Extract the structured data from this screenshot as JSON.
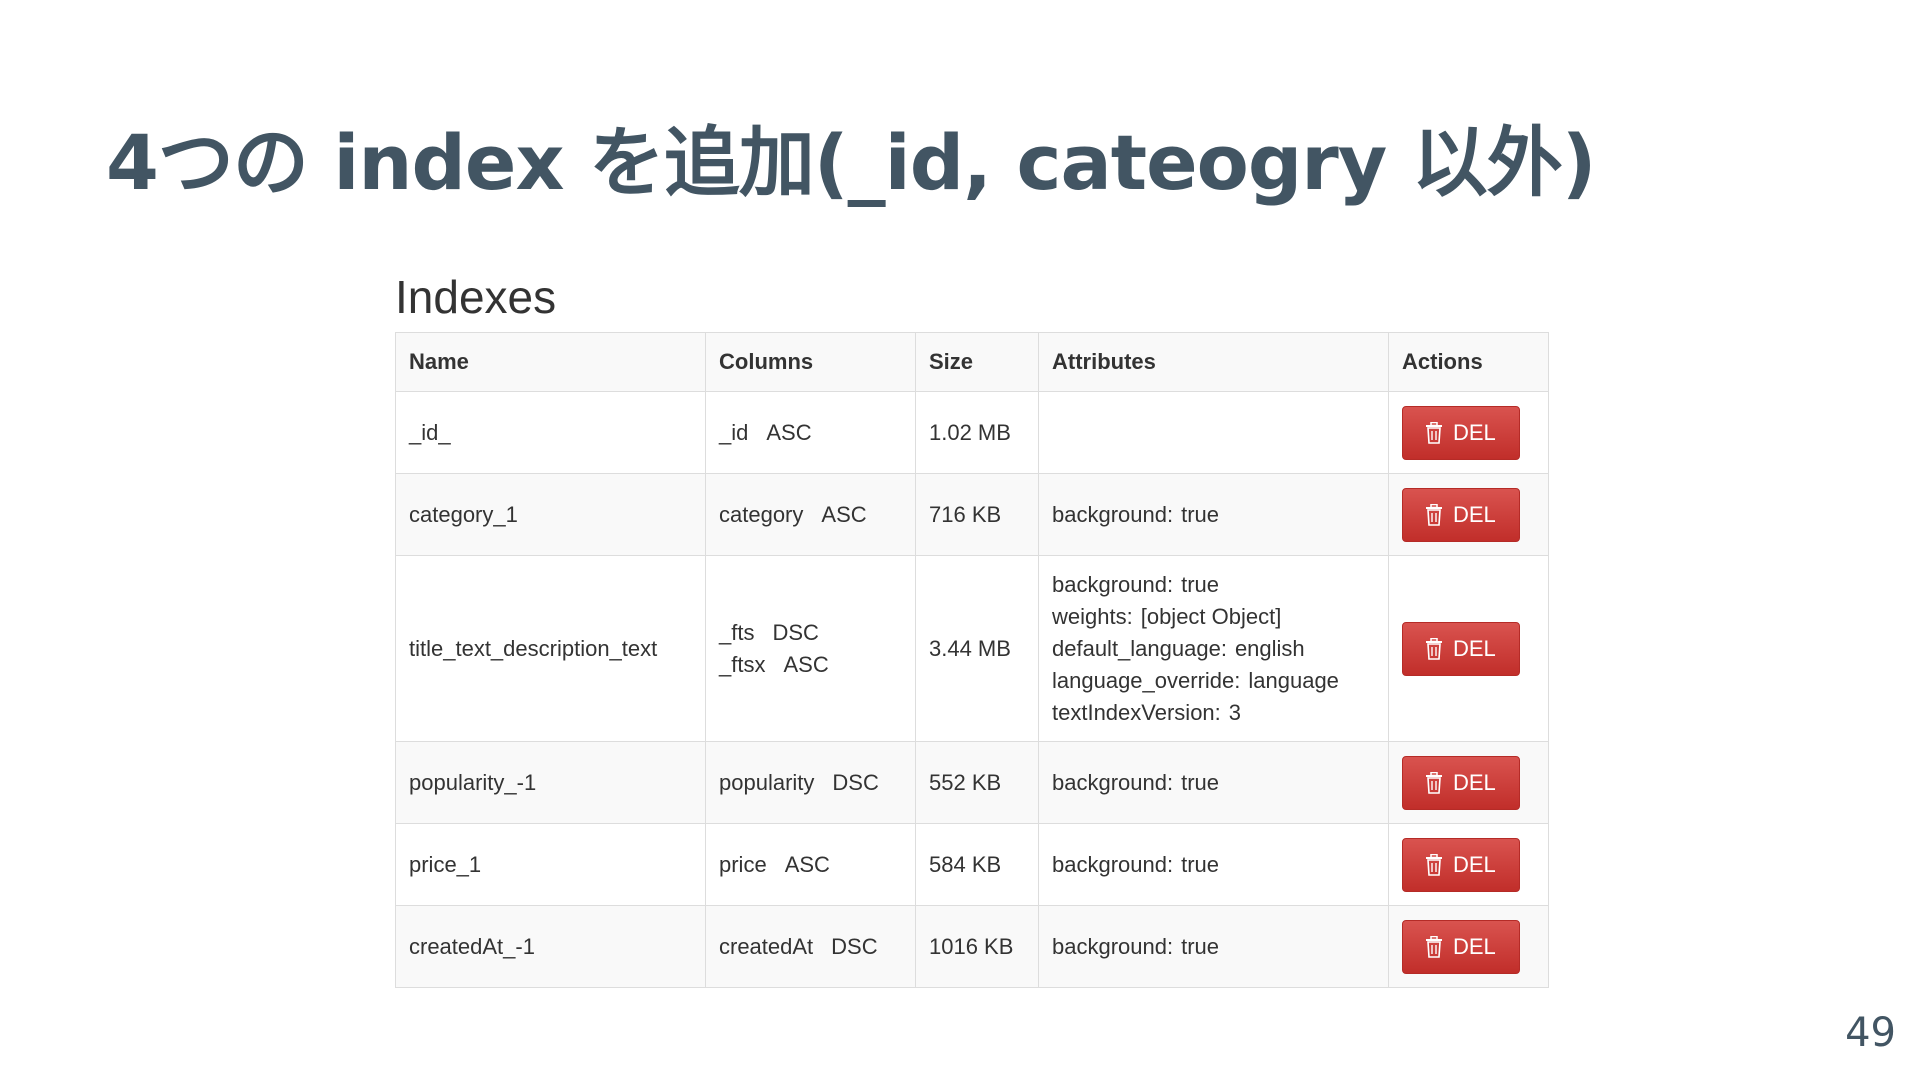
{
  "slide": {
    "title": "4つの index を追加(_id, cateogry 以外)",
    "page_number": "49"
  },
  "panel": {
    "heading": "Indexes",
    "columns": {
      "name": "Name",
      "columns": "Columns",
      "size": "Size",
      "attributes": "Attributes",
      "actions": "Actions"
    },
    "delete_label": "DEL",
    "delete_icon": "trash-icon",
    "accent_color": "#d9534f",
    "rows": [
      {
        "name": "_id_",
        "columns": [
          {
            "field": "_id",
            "dir": "ASC"
          }
        ],
        "size": "1.02 MB",
        "attributes": []
      },
      {
        "name": "category_1",
        "columns": [
          {
            "field": "category",
            "dir": "ASC"
          }
        ],
        "size": "716 KB",
        "attributes": [
          {
            "key": "background:",
            "value": "true"
          }
        ]
      },
      {
        "name": "title_text_description_text",
        "columns": [
          {
            "field": "_fts",
            "dir": "DSC"
          },
          {
            "field": "_ftsx",
            "dir": "ASC"
          }
        ],
        "size": "3.44 MB",
        "attributes": [
          {
            "key": "background:",
            "value": "true"
          },
          {
            "key": "weights:",
            "value": "[object Object]"
          },
          {
            "key": "default_language:",
            "value": "english"
          },
          {
            "key": "language_override:",
            "value": "language"
          },
          {
            "key": "textIndexVersion:",
            "value": "3"
          }
        ]
      },
      {
        "name": "popularity_-1",
        "columns": [
          {
            "field": "popularity",
            "dir": "DSC"
          }
        ],
        "size": "552 KB",
        "attributes": [
          {
            "key": "background:",
            "value": "true"
          }
        ]
      },
      {
        "name": "price_1",
        "columns": [
          {
            "field": "price",
            "dir": "ASC"
          }
        ],
        "size": "584 KB",
        "attributes": [
          {
            "key": "background:",
            "value": "true"
          }
        ]
      },
      {
        "name": "createdAt_-1",
        "columns": [
          {
            "field": "createdAt",
            "dir": "DSC"
          }
        ],
        "size": "1016 KB",
        "attributes": [
          {
            "key": "background:",
            "value": "true"
          }
        ]
      }
    ]
  }
}
